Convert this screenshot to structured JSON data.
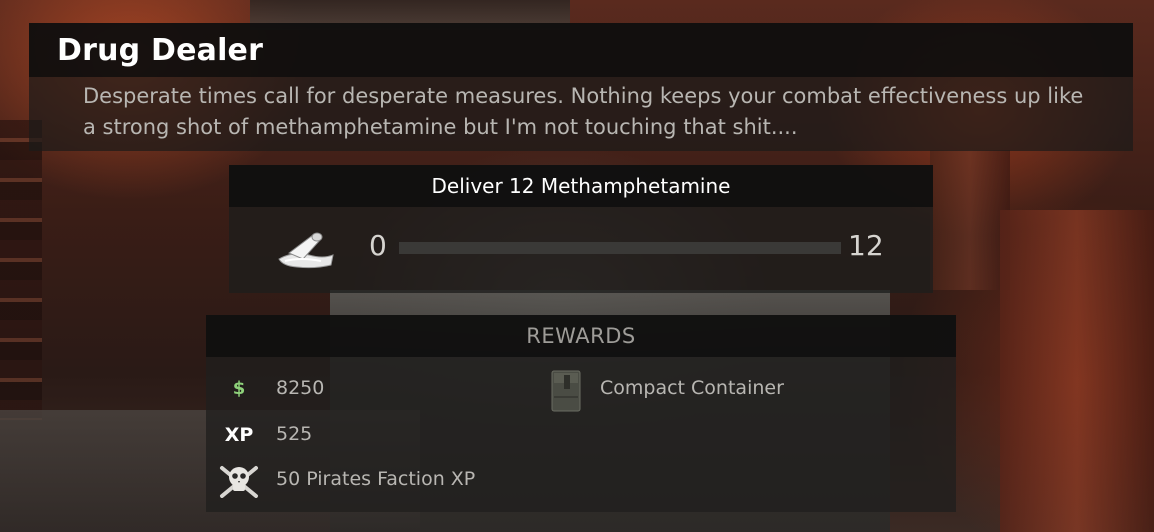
{
  "mission": {
    "title": "Drug Dealer",
    "description": "Desperate times call for desperate measures. Nothing keeps your combat effectiveness up like a strong shot of methamphetamine but I'm not touching that shit...."
  },
  "objective": {
    "title": "Deliver 12 Methamphetamine",
    "item_icon": "methamphetamine-bag-icon",
    "current": "0",
    "total": "12",
    "progress_fraction": 0
  },
  "rewards": {
    "title": "REWARDS",
    "money": {
      "icon": "dollar-icon",
      "value": "8250"
    },
    "xp": {
      "icon": "xp-icon",
      "label": "XP",
      "value": "525"
    },
    "faction": {
      "icon": "pirate-skull-icon",
      "value": "50 Pirates Faction XP"
    },
    "item": {
      "icon": "container-icon",
      "value": "Compact Container"
    }
  },
  "colors": {
    "money_green": "#8ed17a",
    "text_light": "#b8b6b2",
    "title_white": "#ffffff"
  }
}
